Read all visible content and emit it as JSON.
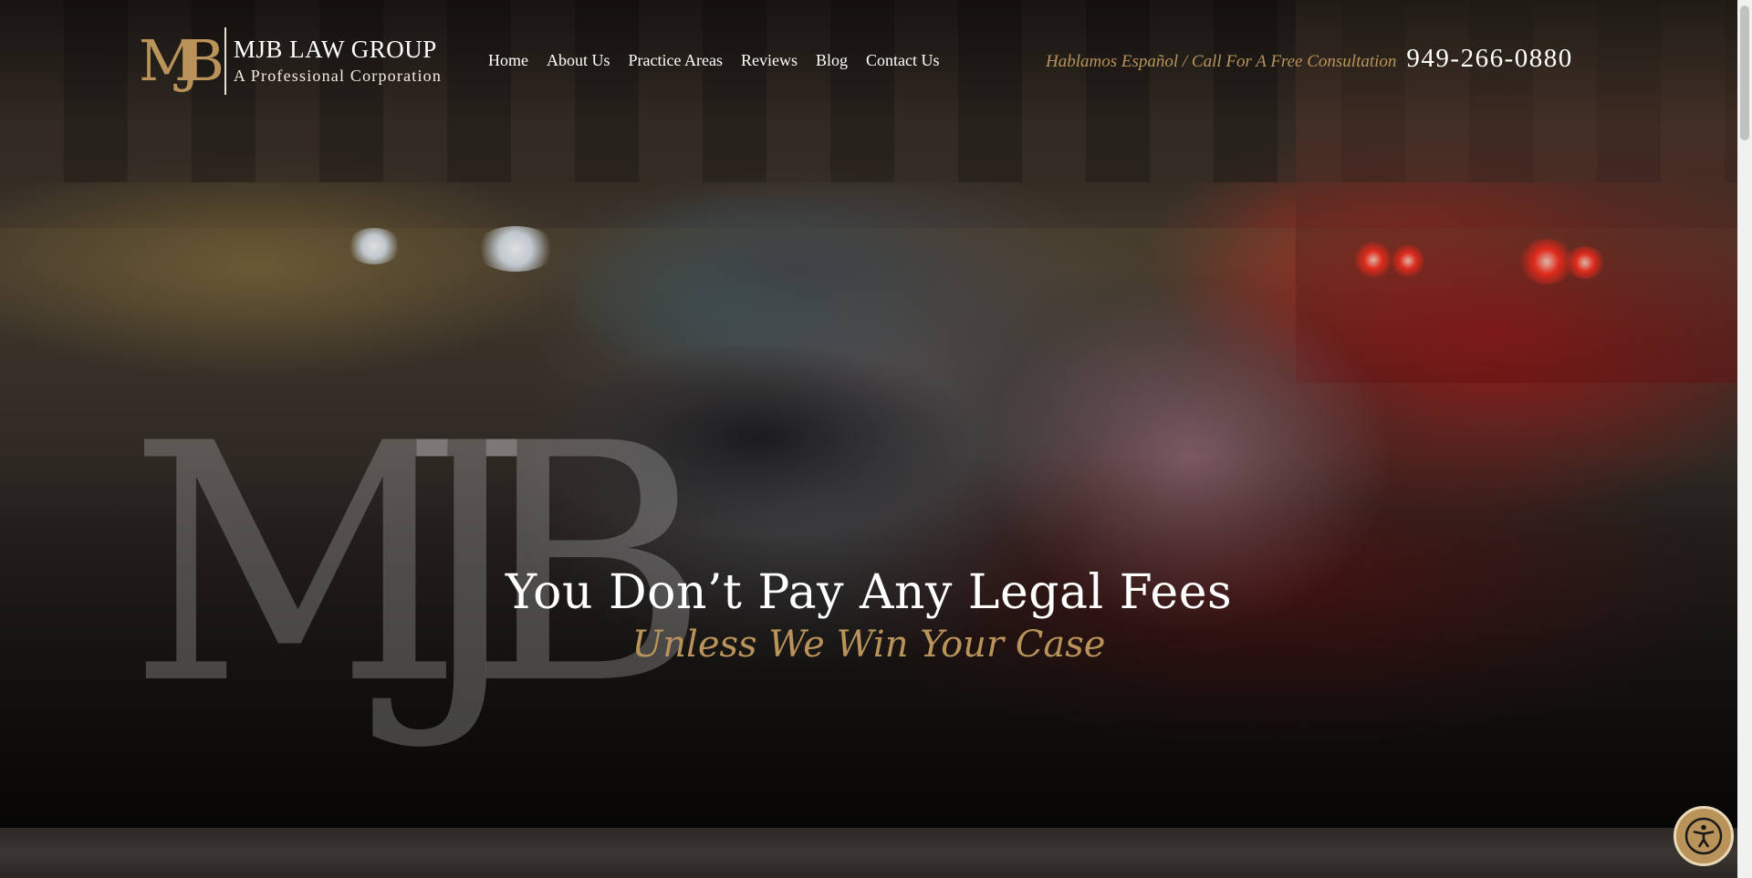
{
  "header": {
    "logo_mark": "MJB",
    "logo_title": "MJB LAW GROUP",
    "logo_subtitle": "A Professional Corporation",
    "nav": [
      {
        "label": "Home"
      },
      {
        "label": "About Us"
      },
      {
        "label": "Practice Areas"
      },
      {
        "label": "Reviews"
      },
      {
        "label": "Blog"
      },
      {
        "label": "Contact Us"
      }
    ],
    "spanish_text": "Hablamos Español / Call For A Free Consultation",
    "phone": "949-266-0880"
  },
  "hero": {
    "watermark": "MJB",
    "headline": "You Don’t Pay Any Legal Fees",
    "subheadline": "Unless We Win Your Case"
  },
  "accessibility": {
    "icon": "accessibility-icon"
  },
  "colors": {
    "accent_gold": "#b9935a",
    "text_white": "#ffffff"
  }
}
